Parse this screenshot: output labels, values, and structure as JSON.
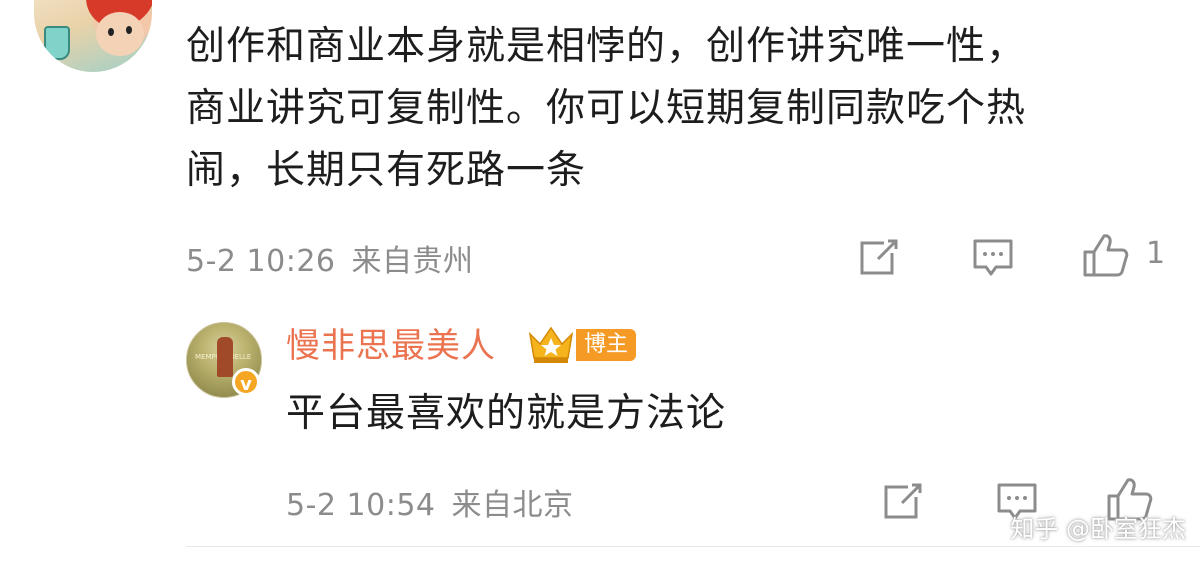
{
  "comment": {
    "text": "创作和商业本身就是相悖的，创作讲究唯一性，\n商业讲究可复制性。你可以短期复制同款吃个热\n闹，长期只有死路一条",
    "time": "5-2 10:26",
    "source": "来自贵州",
    "like_count": "1"
  },
  "reply": {
    "username": "慢非思最美人",
    "badge": "博主",
    "verified_mark": "v",
    "avatar_text": "MEMPHIS BELLE",
    "text": "平台最喜欢的就是方法论",
    "time": "5-2 10:54",
    "source": "来自北京"
  },
  "watermark": "知乎 @卧室狂杰",
  "colors": {
    "username": "#eb7350",
    "badge_bg": "#f59a24",
    "meta": "#8c8c8c"
  },
  "icons": [
    "share-icon",
    "comment-icon",
    "like-icon",
    "crown-icon",
    "verified-icon"
  ]
}
